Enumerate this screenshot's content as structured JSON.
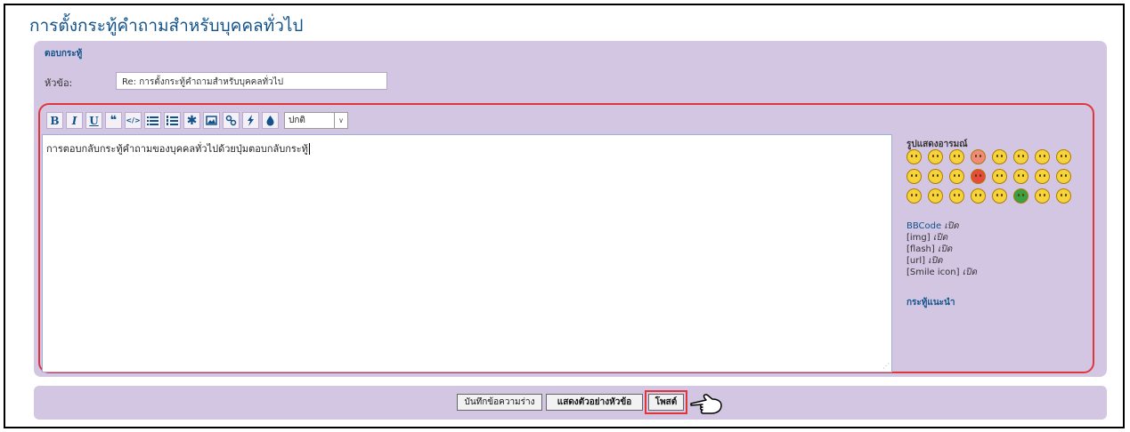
{
  "page": {
    "title": "การตั้งกระทู้คำถามสำหรับบุคคลทั่วไป"
  },
  "reply_form": {
    "section_title": "ตอบกระทู้",
    "subject_label": "หัวข้อ:",
    "subject_value": "Re: การตั้งกระทู้คำถามสำหรับบุคคลทั่วไป"
  },
  "toolbar": {
    "buttons": [
      "B",
      "I",
      "U",
      "quote",
      "code",
      "list",
      "list-numbered",
      "list-item",
      "image",
      "url",
      "flash",
      "color"
    ],
    "font_size_value": "ปกติ"
  },
  "editor": {
    "message_text": "การตอบกลับกระทู้คำถามของบุคคลทั่วไปด้วยปุ่มตอบกลับกระทู้"
  },
  "smilies": {
    "title": "รูปแสดงอารมณ์",
    "colors": [
      "#f5d33b",
      "#f5d33b",
      "#f5d33b",
      "#f08a7a",
      "#f5d33b",
      "#f5d33b",
      "#f5d33b",
      "#f5d33b",
      "#f5d33b",
      "#f5d33b",
      "#f5d33b",
      "#e64b3c",
      "#f5d33b",
      "#f5d33b",
      "#f5d33b",
      "#f5d33b",
      "#f5d33b",
      "#f5d33b",
      "#f5d33b",
      "#f5d33b",
      "#f5d33b",
      "#3aa044",
      "#f5d33b",
      "#f5d33b"
    ]
  },
  "status": {
    "bbcode": "BBCode",
    "img": "[img]",
    "flash": "[flash]",
    "url": "[url]",
    "smilies": "[Smile icon]",
    "state": "เปิด"
  },
  "topic_review_label": "กระทู้แนะนำ",
  "buttons": {
    "save_draft": "บันทึกข้อความร่าง",
    "preview": "แสดงตัวอย่างหัวข้อ",
    "post": "โพสต์"
  }
}
